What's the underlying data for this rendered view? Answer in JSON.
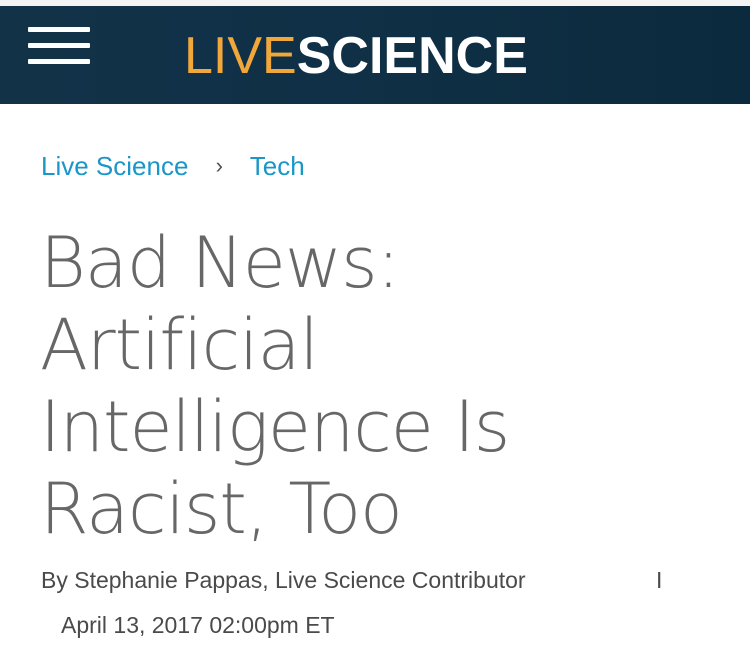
{
  "header": {
    "logo_live": "LIVE",
    "logo_science": "SCIENCE",
    "menu_icon": "hamburger-menu-icon",
    "background_color": "#0f3046",
    "logo_accent_color": "#f2a73a"
  },
  "breadcrumb": {
    "items": [
      {
        "label": "Live Science"
      },
      {
        "label": "Tech"
      }
    ],
    "separator": "›",
    "link_color": "#1a96c9"
  },
  "article": {
    "title_lines": [
      "Bad News:",
      "Artificial",
      "Intelligence Is",
      "Racist, Too"
    ],
    "byline": "By Stephanie Pappas, Live Science Contributor",
    "byline_divider": "I",
    "date": "April 13, 2017 02:00pm ET",
    "title_color": "#676767"
  }
}
